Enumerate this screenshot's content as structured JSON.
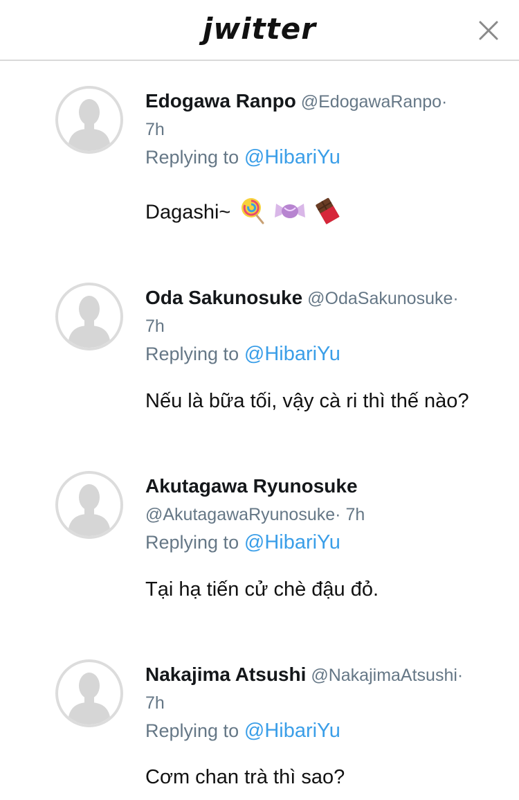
{
  "header": {
    "logo_text": "jwitter",
    "close_icon": "close-icon"
  },
  "replies": [
    {
      "name": "Edogawa Ranpo",
      "handle": "@EdogawaRanpo",
      "separator": "·",
      "time": "7h",
      "replying_prefix": "Replying to",
      "replying_to": "@HibariYu",
      "text": "Dagashi~",
      "emojis": [
        "lollipop-emoji",
        "candy-emoji",
        "chocolate-bar-emoji"
      ]
    },
    {
      "name": "Oda Sakunosuke",
      "handle": "@OdaSakunosuke",
      "separator": "·",
      "time": "7h",
      "replying_prefix": "Replying to",
      "replying_to": "@HibariYu",
      "text": "Nếu là bữa tối, vậy cà ri thì thế nào?"
    },
    {
      "name": "Akutagawa Ryunosuke",
      "handle": "@AkutagawaRyunosuke",
      "separator": "·",
      "time": "7h",
      "replying_prefix": "Replying to",
      "replying_to": "@HibariYu",
      "text": "Tại hạ tiến cử chè đậu đỏ."
    },
    {
      "name": "Nakajima Atsushi",
      "handle": "@NakajimaAtsushi",
      "separator": "·",
      "time": "7h",
      "replying_prefix": "Replying to",
      "replying_to": "@HibariYu",
      "text": "Cơm chan trà thì sao?"
    }
  ],
  "colors": {
    "mention": "#3a9ee8",
    "muted": "#657786",
    "avatar_border": "#dcdcdc",
    "avatar_silhouette": "#d6d6d6"
  }
}
